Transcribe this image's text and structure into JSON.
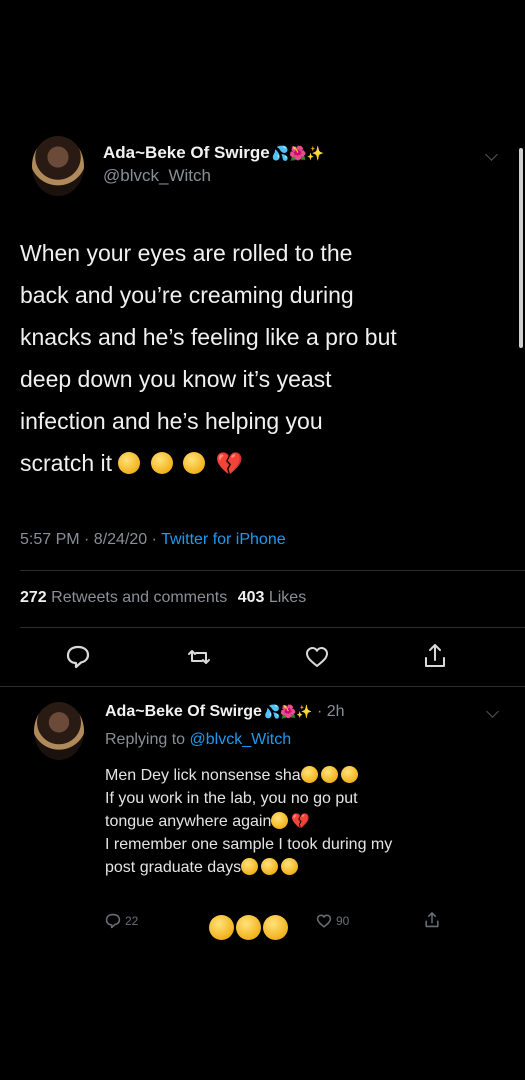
{
  "main_tweet": {
    "display_name": "Ada~Beke Of Swirge",
    "name_emojis": "💦🌺✨",
    "handle": "@blvck_Witch",
    "text_lines": [
      "When your eyes are rolled to the",
      "back and you’re creaming during",
      "knacks and he’s feeling like a pro but",
      "deep down you know it’s yeast",
      "infection and he’s helping you",
      "scratch it"
    ],
    "time": "5:57 PM · 8/24/20 · ",
    "source": "Twitter for iPhone",
    "retweets_count": "272",
    "retweets_label": "Retweets and comments",
    "likes_count": "403",
    "likes_label": "Likes"
  },
  "reply": {
    "display_name": "Ada~Beke Of Swirge",
    "name_emojis": "💦🌺✨",
    "age": "· 2h",
    "replying_prefix": "Replying to ",
    "replying_handle": "@blvck_Witch",
    "text_lines": [
      "Men Dey lick nonsense sha",
      "If you work in the lab, you no go put",
      "tongue anywhere again",
      "I remember one sample I took during my",
      "post graduate days"
    ],
    "reply_count": "22",
    "like_count": "90"
  },
  "icons": {
    "reply": "reply-bubble-icon",
    "retweet": "retweet-icon",
    "like": "heart-icon",
    "share": "share-icon",
    "more": "chevron-down-icon"
  },
  "colors": {
    "background": "#000000",
    "link": "#1d9bf0",
    "muted": "#8a8f96"
  }
}
